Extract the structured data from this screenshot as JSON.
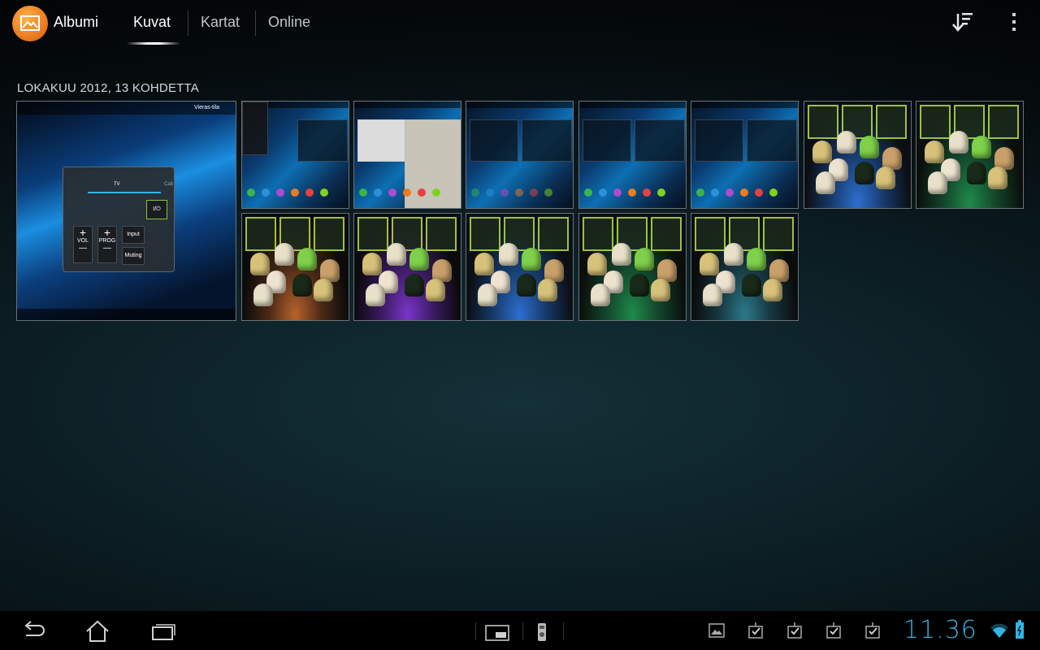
{
  "app": {
    "title": "Albumi",
    "icon": "gallery-icon"
  },
  "tabs": [
    {
      "label": "Kuvat",
      "active": true
    },
    {
      "label": "Kartat",
      "active": false
    },
    {
      "label": "Online",
      "active": false
    }
  ],
  "actions": {
    "sort": "sort-icon",
    "overflow": "overflow-menu-icon"
  },
  "section": {
    "header": "LOKAKUU 2012, 13 KOHDETTA"
  },
  "featured": {
    "status_label": "Vieras-tila",
    "remote_tabs": [
      "TV",
      "Cab"
    ],
    "power_label": "I/⏻",
    "vol_label": "VOL",
    "prog_label": "PROG",
    "input_label": "Input",
    "muting_label": "Muting",
    "plus": "+",
    "minus": "—"
  },
  "thumbnails": [
    {
      "kind": "screenshot",
      "variant": "keypad"
    },
    {
      "kind": "screenshot",
      "variant": "browser"
    },
    {
      "kind": "screenshot",
      "variant": "dark"
    },
    {
      "kind": "screenshot",
      "variant": "home"
    },
    {
      "kind": "screenshot",
      "variant": "home2"
    },
    {
      "kind": "photo",
      "tint": "blue"
    },
    {
      "kind": "photo",
      "tint": "green"
    },
    {
      "kind": "photo",
      "tint": "orange"
    },
    {
      "kind": "photo",
      "tint": "purple"
    },
    {
      "kind": "photo",
      "tint": "blue"
    },
    {
      "kind": "photo",
      "tint": "green"
    },
    {
      "kind": "photo",
      "tint": "mixed"
    }
  ],
  "system_bar": {
    "nav": [
      "back-icon",
      "home-icon",
      "recent-apps-icon"
    ],
    "center": [
      "small-app-icon",
      "remote-app-icon"
    ],
    "notifications": [
      "screenshot-notification-icon",
      "download-done-icon",
      "download-done-icon",
      "download-done-icon",
      "download-done-icon"
    ],
    "clock": "11.36",
    "status": [
      "wifi-icon",
      "battery-icon"
    ],
    "accent": "#33b5e5"
  }
}
